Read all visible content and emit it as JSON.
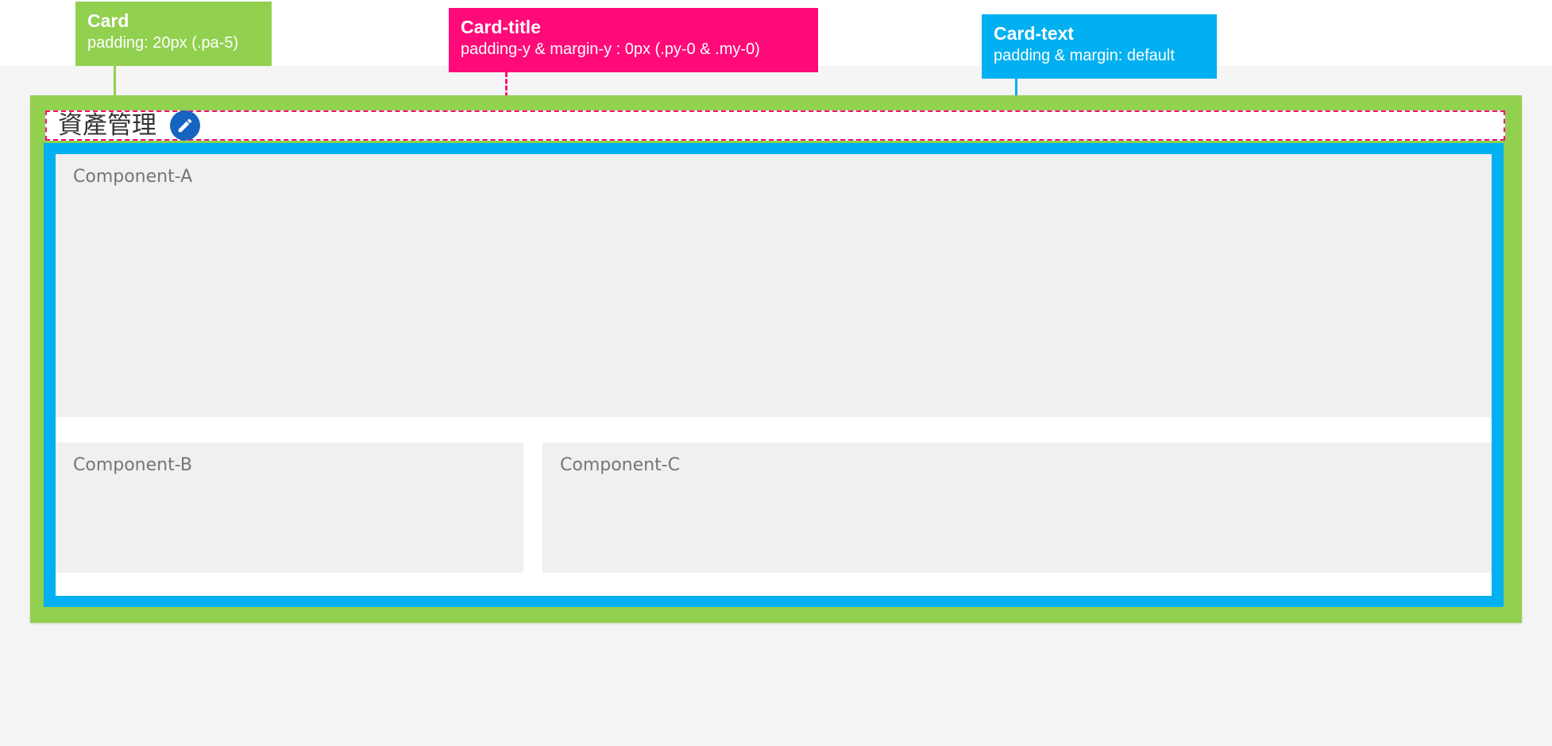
{
  "callouts": {
    "card": {
      "title": "Card",
      "description": "padding: 20px (.pa-5)",
      "color": "#92d050"
    },
    "card_title": {
      "title": "Card-title",
      "description": "padding-y & margin-y : 0px (.py-0 & .my-0)",
      "color": "#ff0a78"
    },
    "card_text": {
      "title": "Card-text",
      "description": "padding & margin: default",
      "color": "#00b0f0"
    }
  },
  "card": {
    "title": "資產管理",
    "edit_icon": "pencil-icon",
    "edit_button_color": "#1565c0",
    "components": {
      "a": "Component-A",
      "b": "Component-B",
      "c": "Component-C"
    }
  }
}
